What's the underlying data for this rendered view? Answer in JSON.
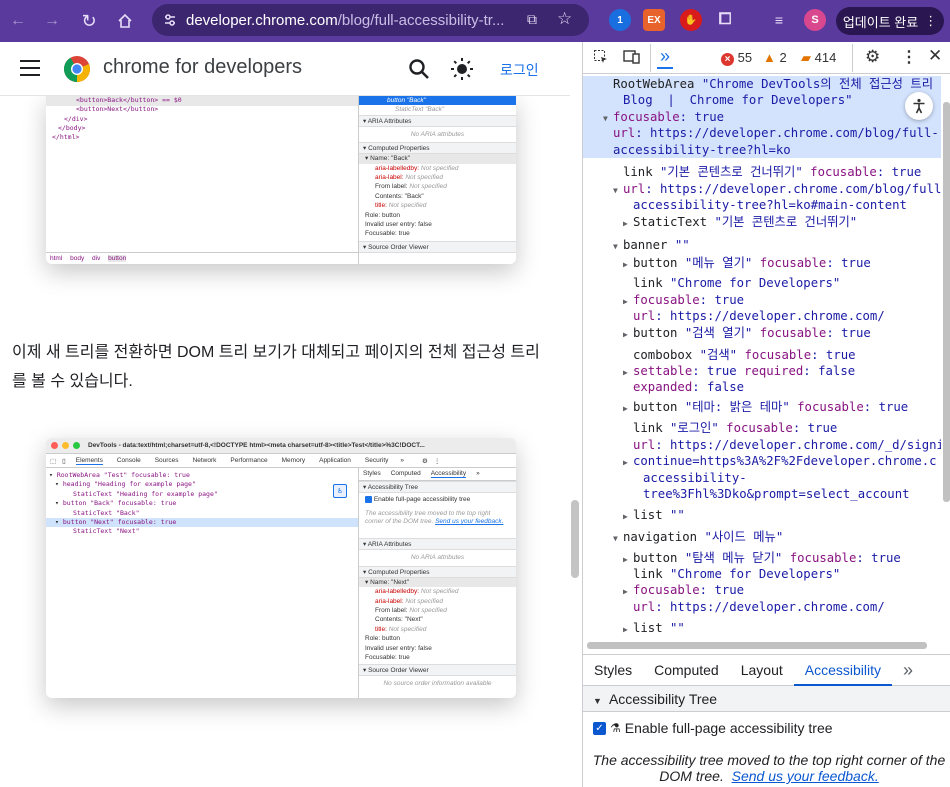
{
  "browser": {
    "url_host": "developer.chrome.com",
    "url_path": "/blog/full-accessibility-tr...",
    "update_label": "업데이트 완료",
    "profile_initial": "S",
    "extensions": [
      "1",
      "EX"
    ]
  },
  "site": {
    "brand": "chrome for developers",
    "login": "로그인"
  },
  "shot1": {
    "code": [
      "<button>Back</button> == $0",
      "<button>Next</button>",
      "</div>",
      "</body>",
      "</html>"
    ],
    "crumbs": [
      "html",
      "body",
      "div",
      "button"
    ],
    "selected_node": "button \"Back\"",
    "static_text": "StaticText \"Back\"",
    "aria_header": "ARIA Attributes",
    "no_aria": "No ARIA attributes",
    "computed_header": "Computed Properties",
    "name_row": "Name: \"Back\"",
    "props": [
      {
        "k": "aria-labelledby:",
        "v": "Not specified"
      },
      {
        "k": "aria-label:",
        "v": "Not specified"
      },
      {
        "k": "From label:",
        "v": "Not specified"
      },
      {
        "k": "Contents:",
        "v": "\"Back\""
      },
      {
        "k": "title:",
        "v": "Not specified"
      }
    ],
    "role": "Role: button",
    "invalid": "Invalid user entry: false",
    "focusable": "Focusable: true",
    "source_order": "Source Order Viewer"
  },
  "paragraph": "이제 새 트리를 전환하면 DOM 트리 보기가 대체되고 페이지의 전체 접근성 트리를 볼 수 있습니다.",
  "shot2": {
    "title": "DevTools - data:text/html;charset=utf-8,<!DOCTYPE html><meta charset=utf-8><title>Test</title>%3C!DOCT...",
    "tabs": [
      "Elements",
      "Console",
      "Sources",
      "Network",
      "Performance",
      "Memory",
      "Application",
      "Security"
    ],
    "tree": [
      "RootWebArea \"Test\" focusable: true",
      "heading \"Heading for example page\"",
      "StaticText \"Heading for example page\"",
      "button \"Back\" focusable: true",
      "StaticText \"Back\"",
      "button \"Next\" focusable: true",
      "StaticText \"Next\""
    ],
    "side_tabs": [
      "Styles",
      "Computed",
      "Accessibility"
    ],
    "a11y_tree": "Accessibility Tree",
    "enable": "Enable full-page accessibility tree",
    "moved": "The accessibility tree moved to the top right corner of the DOM tree.",
    "feedback": "Send us your feedback.",
    "aria_header": "ARIA Attributes",
    "no_aria": "No ARIA attributes",
    "computed_header": "Computed Properties",
    "name_row": "Name: \"Next\"",
    "props": [
      {
        "k": "aria-labelledby:",
        "v": "Not specified"
      },
      {
        "k": "aria-label:",
        "v": "Not specified"
      },
      {
        "k": "From label:",
        "v": "Not specified"
      },
      {
        "k": "Contents:",
        "v": "\"Next\""
      },
      {
        "k": "title:",
        "v": "Not specified"
      }
    ],
    "role": "Role: button",
    "invalid": "Invalid user entry: false",
    "focusable": "Focusable: true",
    "source_order": "Source Order Viewer",
    "no_source": "No source order information available"
  },
  "devtools": {
    "errors": "55",
    "warnings": "2",
    "issues": "414",
    "tree": [
      {
        "d": 0,
        "t": "",
        "role": "RootWebArea",
        "q": "\"Chrome DevTools의 전체 접근성 트리  |",
        "sel": true
      },
      {
        "d": 1,
        "t": "",
        "role": "",
        "q": "Blog  |  Chrome for Developers\"",
        "sel": true
      },
      {
        "d": 0,
        "t": "▼",
        "role": "",
        "attr": "focusable",
        "val": "true",
        "sel": true
      },
      {
        "d": 0,
        "t": "",
        "role": "",
        "attr": "url",
        "val": "https://developer.chrome.com/blog/full-",
        "sel": true
      },
      {
        "d": 0,
        "t": "",
        "role": "",
        "q": "accessibility-tree?hl=ko",
        "sel": true
      },
      {
        "d": 1,
        "t": "",
        "role": "link",
        "q": "\"기본 콘텐츠로 건너뛰기\"",
        "attr": "focusable",
        "val": "true"
      },
      {
        "d": 1,
        "t": "▼",
        "role": "",
        "attr": "url",
        "val": "https://developer.chrome.com/blog/full-"
      },
      {
        "d": 2,
        "t": "",
        "role": "",
        "q": "accessibility-tree?hl=ko#main-content"
      },
      {
        "d": 2,
        "t": "▶",
        "role": "StaticText",
        "q": "\"기본 콘텐츠로 건너뛰기\""
      },
      {
        "d": 1,
        "t": "▼",
        "role": "banner",
        "q": "\"\""
      },
      {
        "d": 2,
        "t": "▶",
        "role": "button",
        "q": "\"메뉴 열기\"",
        "attr": "focusable",
        "val": "true"
      },
      {
        "d": 2,
        "t": "",
        "role": "link",
        "q": "\"Chrome for Developers\""
      },
      {
        "d": 2,
        "t": "▶",
        "role": "",
        "attr": "focusable",
        "val": "true"
      },
      {
        "d": 2,
        "t": "",
        "role": "",
        "attr": "url",
        "val": "https://developer.chrome.com/"
      },
      {
        "d": 2,
        "t": "▶",
        "role": "button",
        "q": "\"검색 열기\"",
        "attr": "focusable",
        "val": "true"
      },
      {
        "d": 2,
        "t": "",
        "role": "combobox",
        "q": "\"검색\"",
        "attr": "focusable",
        "val": "true"
      },
      {
        "d": 2,
        "t": "▶",
        "role": "",
        "attr": "settable",
        "val": "true",
        "attr2": "required",
        "val2": "false"
      },
      {
        "d": 2,
        "t": "",
        "role": "",
        "attr": "expanded",
        "val": "false"
      },
      {
        "d": 2,
        "t": "▶",
        "role": "button",
        "q": "\"테마: 밝은 테마\"",
        "attr": "focusable",
        "val": "true"
      },
      {
        "d": 2,
        "t": "",
        "role": "link",
        "q": "\"로그인\"",
        "attr": "focusable",
        "val": "true"
      },
      {
        "d": 2,
        "t": "",
        "role": "",
        "attr": "url",
        "val": "https://developer.chrome.com/_d/signi"
      },
      {
        "d": 2,
        "t": "▶",
        "role": "",
        "q": "continue=https%3A%2F%2Fdeveloper.chrome.c"
      },
      {
        "d": 3,
        "t": "",
        "role": "",
        "q": "accessibility-"
      },
      {
        "d": 3,
        "t": "",
        "role": "",
        "q": "tree%3Fhl%3Dko&prompt=select_account"
      },
      {
        "d": 2,
        "t": "▶",
        "role": "list",
        "q": "\"\""
      },
      {
        "d": 1,
        "t": "▼",
        "role": "navigation",
        "q": "\"사이드 메뉴\""
      },
      {
        "d": 2,
        "t": "▶",
        "role": "button",
        "q": "\"탐색 메뉴 닫기\"",
        "attr": "focusable",
        "val": "true"
      },
      {
        "d": 2,
        "t": "",
        "role": "link",
        "q": "\"Chrome for Developers\""
      },
      {
        "d": 2,
        "t": "▶",
        "role": "",
        "attr": "focusable",
        "val": "true"
      },
      {
        "d": 2,
        "t": "",
        "role": "",
        "attr": "url",
        "val": "https://developer.chrome.com/"
      },
      {
        "d": 2,
        "t": "▶",
        "role": "list",
        "q": "\"\""
      }
    ],
    "tabs": [
      "Styles",
      "Computed",
      "Layout",
      "Accessibility"
    ],
    "active_tab": "Accessibility",
    "a11y_header": "Accessibility Tree",
    "enable_label": "Enable full-page accessibility tree",
    "moved_text": "The accessibility tree moved to the top right corner of the DOM tree.",
    "feedback_link": "Send us your feedback."
  }
}
